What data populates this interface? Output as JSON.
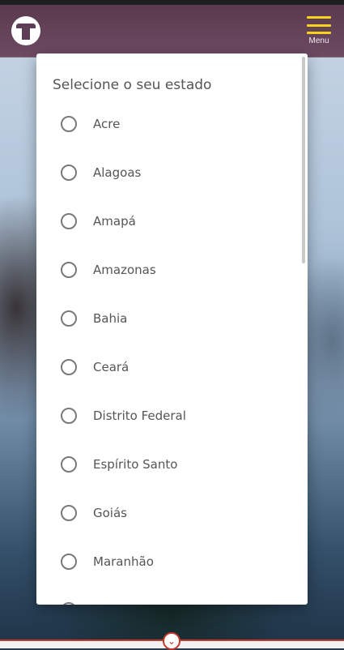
{
  "header": {
    "logo_icon": "bus-stop-logo-icon",
    "menu_label": "Menu",
    "menu_icon": "hamburger-menu-icon",
    "menu_icon_color": "#f6d21c"
  },
  "modal": {
    "title": "Selecione o seu estado",
    "options": [
      {
        "label": "Acre"
      },
      {
        "label": "Alagoas"
      },
      {
        "label": "Amapá"
      },
      {
        "label": "Amazonas"
      },
      {
        "label": "Bahia"
      },
      {
        "label": "Ceará"
      },
      {
        "label": "Distrito Federal"
      },
      {
        "label": "Espírito Santo"
      },
      {
        "label": "Goiás"
      },
      {
        "label": "Maranhão"
      },
      {
        "label": ""
      }
    ]
  },
  "footer": {
    "chevron_icon": "chevron-down-icon",
    "accent_color": "#c0392b"
  }
}
